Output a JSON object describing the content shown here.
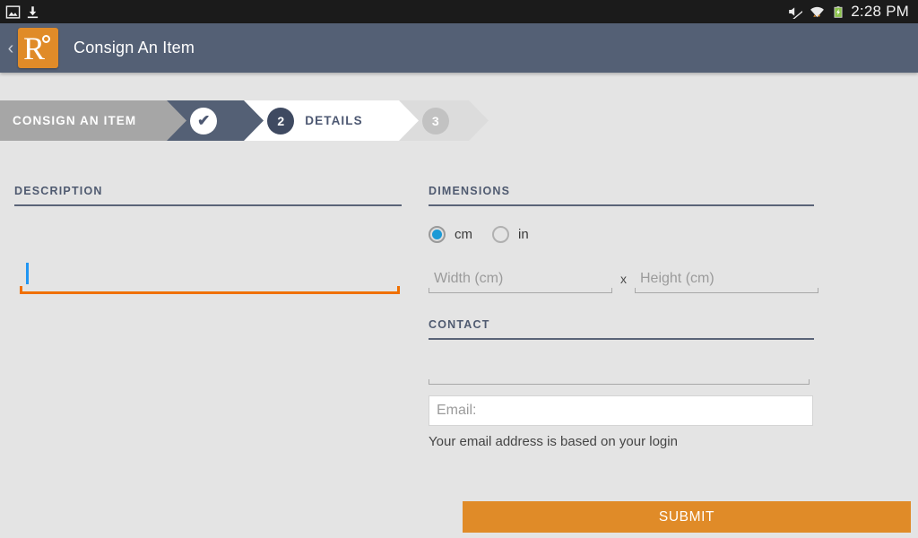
{
  "statusbar": {
    "left_icons": [
      {
        "name": "image-icon",
        "glyph": "image"
      },
      {
        "name": "download-icon",
        "glyph": "download"
      }
    ],
    "right_icons": [
      {
        "name": "mute-icon",
        "glyph": "volume-muted"
      },
      {
        "name": "wifi-icon",
        "glyph": "wifi-transfer"
      },
      {
        "name": "battery-charging-icon",
        "glyph": "battery-charging"
      }
    ],
    "time": "2:28 PM"
  },
  "appbar": {
    "back_label": "‹",
    "logo_letter": "R",
    "title": "Consign An Item"
  },
  "steps": [
    {
      "label": "CONSIGN AN ITEM",
      "state": "done"
    },
    {
      "label": "",
      "badge": "✔",
      "state": "done"
    },
    {
      "label": "DETAILS",
      "badge": "2",
      "state": "current"
    },
    {
      "label": "",
      "badge": "3",
      "state": "upcoming"
    }
  ],
  "description": {
    "heading": "DESCRIPTION",
    "value": "",
    "placeholder": "",
    "focused": true
  },
  "dimensions": {
    "heading": "DIMENSIONS",
    "units": [
      {
        "label": "cm",
        "selected": true
      },
      {
        "label": "in",
        "selected": false
      }
    ],
    "width": {
      "value": "",
      "placeholder": "Width (cm)"
    },
    "separator": "x",
    "height": {
      "value": "",
      "placeholder": "Height (cm)"
    }
  },
  "contact": {
    "heading": "CONTACT",
    "field": {
      "value": "",
      "placeholder": ""
    },
    "email": {
      "value": "",
      "placeholder": "Email:"
    },
    "note": "Your email address is based on your login"
  },
  "actions": {
    "submit_label": "SUBMIT"
  },
  "colors": {
    "accent_orange": "#e08b28",
    "focus_orange": "#f07000",
    "appbar_slate": "#546075",
    "step_current": "#3f4a61",
    "radio_blue": "#1b9ad6",
    "page_bg": "#e4e4e4"
  }
}
